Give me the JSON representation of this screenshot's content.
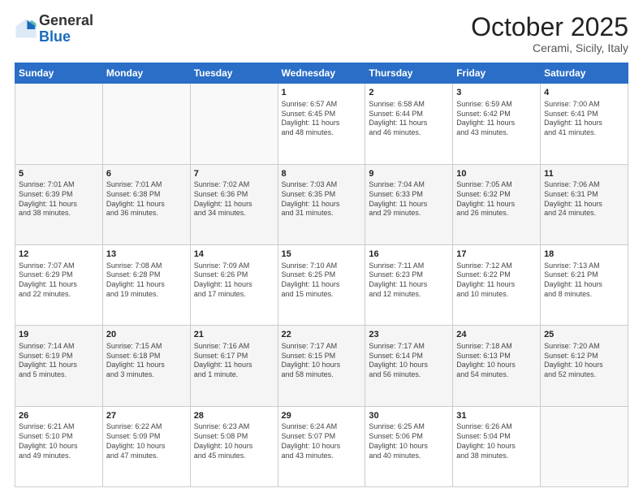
{
  "header": {
    "logo_general": "General",
    "logo_blue": "Blue",
    "month": "October 2025",
    "location": "Cerami, Sicily, Italy"
  },
  "days_of_week": [
    "Sunday",
    "Monday",
    "Tuesday",
    "Wednesday",
    "Thursday",
    "Friday",
    "Saturday"
  ],
  "weeks": [
    [
      {
        "day": "",
        "info": ""
      },
      {
        "day": "",
        "info": ""
      },
      {
        "day": "",
        "info": ""
      },
      {
        "day": "1",
        "info": "Sunrise: 6:57 AM\nSunset: 6:45 PM\nDaylight: 11 hours\nand 48 minutes."
      },
      {
        "day": "2",
        "info": "Sunrise: 6:58 AM\nSunset: 6:44 PM\nDaylight: 11 hours\nand 46 minutes."
      },
      {
        "day": "3",
        "info": "Sunrise: 6:59 AM\nSunset: 6:42 PM\nDaylight: 11 hours\nand 43 minutes."
      },
      {
        "day": "4",
        "info": "Sunrise: 7:00 AM\nSunset: 6:41 PM\nDaylight: 11 hours\nand 41 minutes."
      }
    ],
    [
      {
        "day": "5",
        "info": "Sunrise: 7:01 AM\nSunset: 6:39 PM\nDaylight: 11 hours\nand 38 minutes."
      },
      {
        "day": "6",
        "info": "Sunrise: 7:01 AM\nSunset: 6:38 PM\nDaylight: 11 hours\nand 36 minutes."
      },
      {
        "day": "7",
        "info": "Sunrise: 7:02 AM\nSunset: 6:36 PM\nDaylight: 11 hours\nand 34 minutes."
      },
      {
        "day": "8",
        "info": "Sunrise: 7:03 AM\nSunset: 6:35 PM\nDaylight: 11 hours\nand 31 minutes."
      },
      {
        "day": "9",
        "info": "Sunrise: 7:04 AM\nSunset: 6:33 PM\nDaylight: 11 hours\nand 29 minutes."
      },
      {
        "day": "10",
        "info": "Sunrise: 7:05 AM\nSunset: 6:32 PM\nDaylight: 11 hours\nand 26 minutes."
      },
      {
        "day": "11",
        "info": "Sunrise: 7:06 AM\nSunset: 6:31 PM\nDaylight: 11 hours\nand 24 minutes."
      }
    ],
    [
      {
        "day": "12",
        "info": "Sunrise: 7:07 AM\nSunset: 6:29 PM\nDaylight: 11 hours\nand 22 minutes."
      },
      {
        "day": "13",
        "info": "Sunrise: 7:08 AM\nSunset: 6:28 PM\nDaylight: 11 hours\nand 19 minutes."
      },
      {
        "day": "14",
        "info": "Sunrise: 7:09 AM\nSunset: 6:26 PM\nDaylight: 11 hours\nand 17 minutes."
      },
      {
        "day": "15",
        "info": "Sunrise: 7:10 AM\nSunset: 6:25 PM\nDaylight: 11 hours\nand 15 minutes."
      },
      {
        "day": "16",
        "info": "Sunrise: 7:11 AM\nSunset: 6:23 PM\nDaylight: 11 hours\nand 12 minutes."
      },
      {
        "day": "17",
        "info": "Sunrise: 7:12 AM\nSunset: 6:22 PM\nDaylight: 11 hours\nand 10 minutes."
      },
      {
        "day": "18",
        "info": "Sunrise: 7:13 AM\nSunset: 6:21 PM\nDaylight: 11 hours\nand 8 minutes."
      }
    ],
    [
      {
        "day": "19",
        "info": "Sunrise: 7:14 AM\nSunset: 6:19 PM\nDaylight: 11 hours\nand 5 minutes."
      },
      {
        "day": "20",
        "info": "Sunrise: 7:15 AM\nSunset: 6:18 PM\nDaylight: 11 hours\nand 3 minutes."
      },
      {
        "day": "21",
        "info": "Sunrise: 7:16 AM\nSunset: 6:17 PM\nDaylight: 11 hours\nand 1 minute."
      },
      {
        "day": "22",
        "info": "Sunrise: 7:17 AM\nSunset: 6:15 PM\nDaylight: 10 hours\nand 58 minutes."
      },
      {
        "day": "23",
        "info": "Sunrise: 7:17 AM\nSunset: 6:14 PM\nDaylight: 10 hours\nand 56 minutes."
      },
      {
        "day": "24",
        "info": "Sunrise: 7:18 AM\nSunset: 6:13 PM\nDaylight: 10 hours\nand 54 minutes."
      },
      {
        "day": "25",
        "info": "Sunrise: 7:20 AM\nSunset: 6:12 PM\nDaylight: 10 hours\nand 52 minutes."
      }
    ],
    [
      {
        "day": "26",
        "info": "Sunrise: 6:21 AM\nSunset: 5:10 PM\nDaylight: 10 hours\nand 49 minutes."
      },
      {
        "day": "27",
        "info": "Sunrise: 6:22 AM\nSunset: 5:09 PM\nDaylight: 10 hours\nand 47 minutes."
      },
      {
        "day": "28",
        "info": "Sunrise: 6:23 AM\nSunset: 5:08 PM\nDaylight: 10 hours\nand 45 minutes."
      },
      {
        "day": "29",
        "info": "Sunrise: 6:24 AM\nSunset: 5:07 PM\nDaylight: 10 hours\nand 43 minutes."
      },
      {
        "day": "30",
        "info": "Sunrise: 6:25 AM\nSunset: 5:06 PM\nDaylight: 10 hours\nand 40 minutes."
      },
      {
        "day": "31",
        "info": "Sunrise: 6:26 AM\nSunset: 5:04 PM\nDaylight: 10 hours\nand 38 minutes."
      },
      {
        "day": "",
        "info": ""
      }
    ]
  ]
}
